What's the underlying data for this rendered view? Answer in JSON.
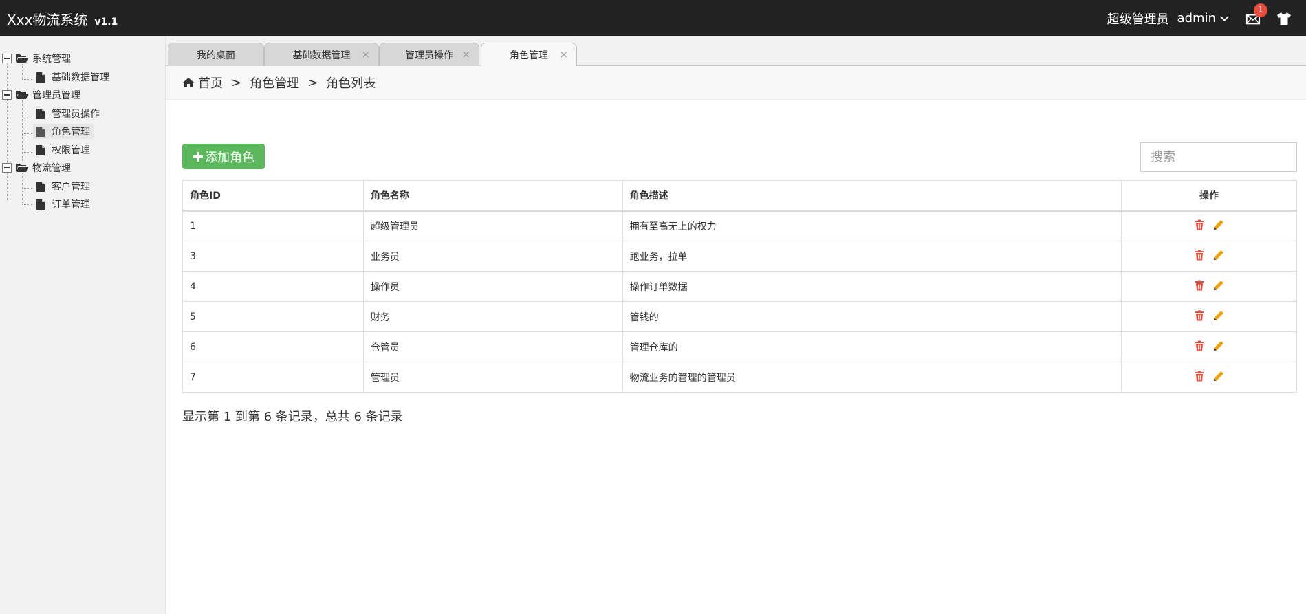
{
  "app": {
    "title": "Xxx物流系统",
    "version": "v1.1"
  },
  "topbar": {
    "role": "超级管理员",
    "user": "admin",
    "mail_count": "1"
  },
  "sidebar": {
    "groups": [
      {
        "label": "系统管理",
        "items": [
          "基础数据管理"
        ]
      },
      {
        "label": "管理员管理",
        "items": [
          "管理员操作",
          "角色管理",
          "权限管理"
        ]
      },
      {
        "label": "物流管理",
        "items": [
          "客户管理",
          "订单管理"
        ]
      }
    ],
    "active_item": "角色管理"
  },
  "tabs": [
    {
      "label": "我的桌面",
      "closable": false
    },
    {
      "label": "基础数据管理",
      "closable": true
    },
    {
      "label": "管理员操作",
      "closable": true
    },
    {
      "label": "角色管理",
      "closable": true,
      "active": true
    }
  ],
  "tab_close_glyph": "×",
  "breadcrumb": {
    "home": "首页",
    "sep": ">",
    "level1": "角色管理",
    "level2": "角色列表"
  },
  "toolbar": {
    "add_label": "添加角色",
    "search_placeholder": "搜索"
  },
  "table": {
    "headers": [
      "角色ID",
      "角色名称",
      "角色描述",
      "操作"
    ],
    "rows": [
      [
        "1",
        "超级管理员",
        "拥有至高无上的权力"
      ],
      [
        "3",
        "业务员",
        "跑业务，拉单"
      ],
      [
        "4",
        "操作员",
        "操作订单数据"
      ],
      [
        "5",
        "财务",
        "管钱的"
      ],
      [
        "6",
        "仓管员",
        "管理仓库的"
      ],
      [
        "7",
        "管理员",
        "物流业务的管理的管理员"
      ]
    ]
  },
  "summary": "显示第 1 到第 6 条记录，总共 6 条记录",
  "colors": {
    "topbar": "#222222",
    "add_button": "#5cb85c",
    "delete_icon": "#e74c3c",
    "edit_icon": "#f0a30a"
  }
}
